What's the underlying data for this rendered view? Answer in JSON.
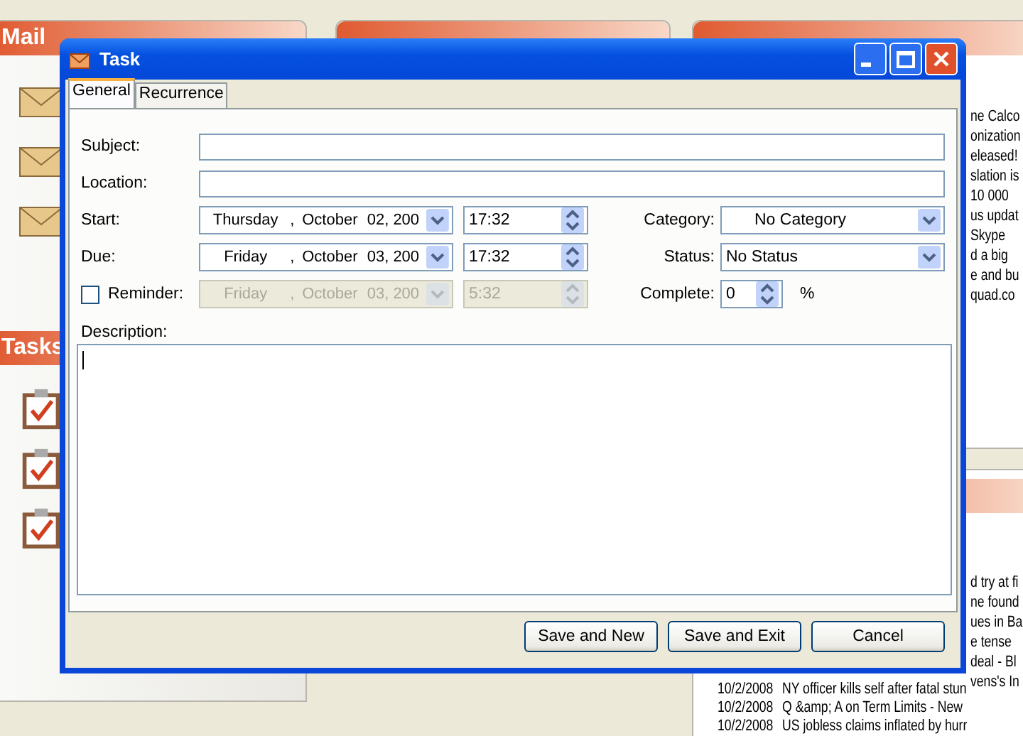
{
  "background": {
    "mail_panel": {
      "title": "Mail"
    },
    "tasks_panel": {
      "title": "Tasks"
    },
    "rss_panel": {
      "lines": [
        "ne Calco",
        "onization",
        "eleased!",
        "slation is",
        "10 000",
        "us updat",
        "Skype",
        "d a big",
        "e and bu",
        "quad.co"
      ]
    },
    "news_panel": {
      "partial_lines": [
        "d try at fi",
        "ne found",
        "ues in Ba",
        "e tense",
        "deal - Bl",
        "vens's In"
      ],
      "rows": [
        {
          "date": "10/2/2008",
          "headline": "NY officer kills self after fatal stun"
        },
        {
          "date": "10/2/2008",
          "headline": "Q &amp; A on Term Limits - New"
        },
        {
          "date": "10/2/2008",
          "headline": "US jobless claims inflated by hurr"
        }
      ]
    }
  },
  "dialog": {
    "title": "Task",
    "tabs": [
      {
        "label": "General",
        "selected": true
      },
      {
        "label": "Recurrence",
        "selected": false
      }
    ],
    "subject": {
      "label": "Subject:"
    },
    "location": {
      "label": "Location:"
    },
    "start": {
      "label": "Start:",
      "weekday": "Thursday",
      "separator": ",",
      "month": "October",
      "date": "02, 200",
      "time": "17:32"
    },
    "due": {
      "label": "Due:",
      "weekday": "Friday",
      "separator": ",",
      "month": "October",
      "date": "03, 200",
      "time": "17:32"
    },
    "reminder": {
      "label": "Reminder:",
      "checked": false,
      "weekday": "Friday",
      "separator": ",",
      "month": "October",
      "date": "03, 200",
      "time": "5:32"
    },
    "category": {
      "label": "Category:",
      "value": "No Category"
    },
    "status": {
      "label": "Status:",
      "value": "No Status"
    },
    "complete": {
      "label": "Complete:",
      "value": "0",
      "unit": "%"
    },
    "description": {
      "label": "Description:"
    },
    "buttons": [
      "Save and New",
      "Save and Exit",
      "Cancel"
    ]
  }
}
